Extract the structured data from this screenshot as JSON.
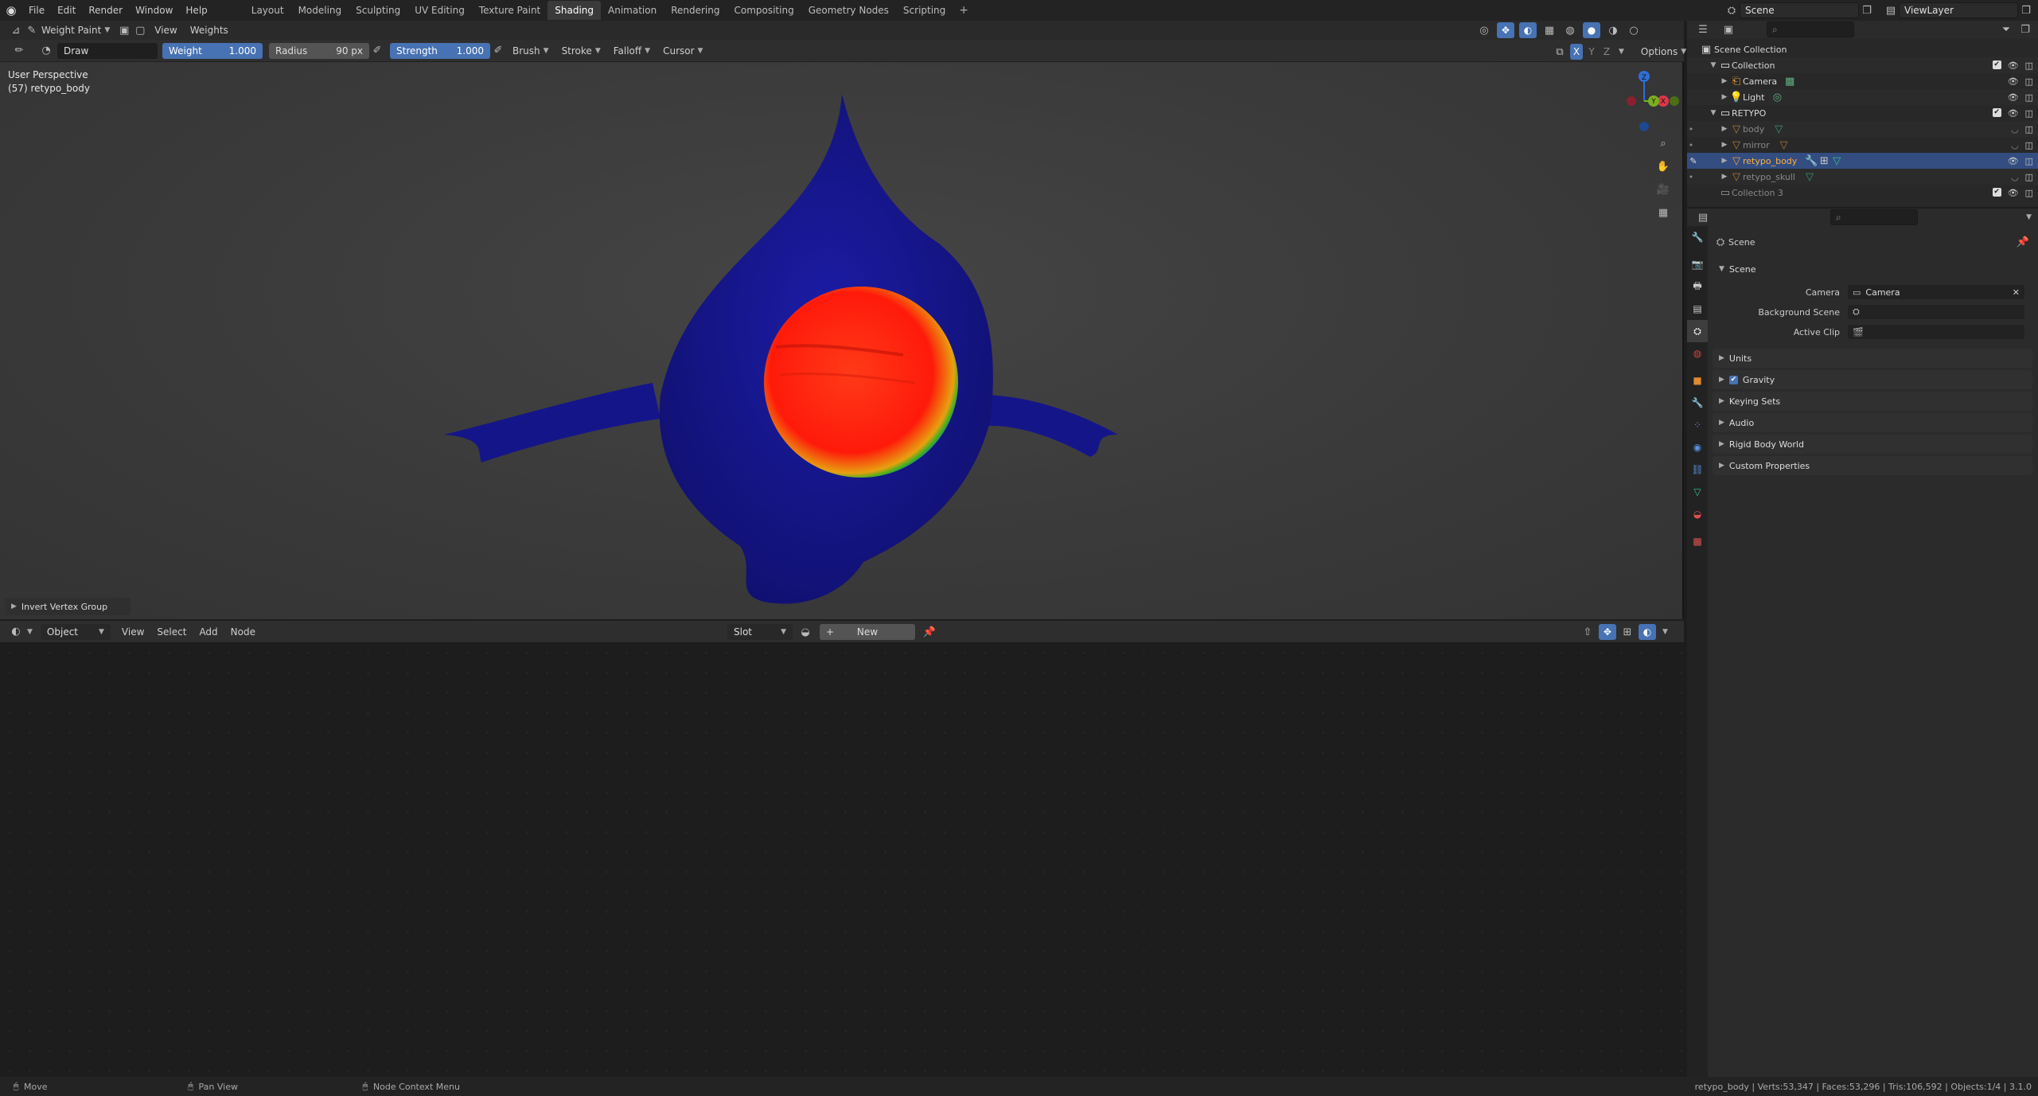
{
  "topbar": {
    "menus": [
      "File",
      "Edit",
      "Render",
      "Window",
      "Help"
    ],
    "workspaces": [
      "Layout",
      "Modeling",
      "Sculpting",
      "UV Editing",
      "Texture Paint",
      "Shading",
      "Animation",
      "Rendering",
      "Compositing",
      "Geometry Nodes",
      "Scripting"
    ],
    "active_workspace": "Shading",
    "plus": "+",
    "scene_name": "Scene",
    "view_layer": "ViewLayer"
  },
  "viewport": {
    "mode": "Weight Paint",
    "menus": [
      "View",
      "Weights"
    ],
    "tool_name": "Draw",
    "weight_label": "Weight",
    "weight_value": "1.000",
    "radius_label": "Radius",
    "radius_value": "90 px",
    "strength_label": "Strength",
    "strength_value": "1.000",
    "brush_menus": [
      "Brush",
      "Stroke",
      "Falloff",
      "Cursor"
    ],
    "axis": [
      "X",
      "Y",
      "Z"
    ],
    "options": "Options",
    "info_line1": "User Perspective",
    "info_line2": "(57) retypo_body",
    "last_op": "Invert Vertex Group",
    "gizmo": {
      "z": "Z",
      "x": "X",
      "y": "Y"
    }
  },
  "node_editor": {
    "object_mode": "Object",
    "menus": [
      "View",
      "Select",
      "Add",
      "Node"
    ],
    "slot": "Slot",
    "new_button": "New"
  },
  "outliner": {
    "root": "Scene Collection",
    "rows": [
      {
        "label": "Collection",
        "indent": 1,
        "type": "collection"
      },
      {
        "label": "Camera",
        "indent": 2,
        "type": "camera"
      },
      {
        "label": "Light",
        "indent": 2,
        "type": "light"
      },
      {
        "label": "RETYPO",
        "indent": 1,
        "type": "collection"
      },
      {
        "label": "body",
        "indent": 2,
        "type": "mesh-dim"
      },
      {
        "label": "mirror",
        "indent": 2,
        "type": "mesh-dim"
      },
      {
        "label": "retypo_body",
        "indent": 2,
        "type": "mesh-selected"
      },
      {
        "label": "retypo_skull",
        "indent": 2,
        "type": "mesh-dim"
      },
      {
        "label": "Collection 3",
        "indent": 1,
        "type": "collection-dim"
      }
    ]
  },
  "properties": {
    "context": "Scene",
    "panel": "Scene",
    "camera_label": "Camera",
    "camera_value": "Camera",
    "background_label": "Background Scene",
    "clip_label": "Active Clip",
    "sections": [
      "Units",
      "Gravity",
      "Keying Sets",
      "Audio",
      "Rigid Body World",
      "Custom Properties"
    ]
  },
  "statusbar": {
    "move": "Move",
    "pan": "Pan View",
    "context_menu": "Node Context Menu",
    "stats": "retypo_body | Verts:53,347 | Faces:53,296 | Tris:106,592 | Objects:1/4 | 3.1.0"
  },
  "colors": {
    "accent": "#4772b3",
    "selected_row": "#334d80",
    "mesh_blue": "#17178f",
    "weight_red": "#ff2a10"
  }
}
